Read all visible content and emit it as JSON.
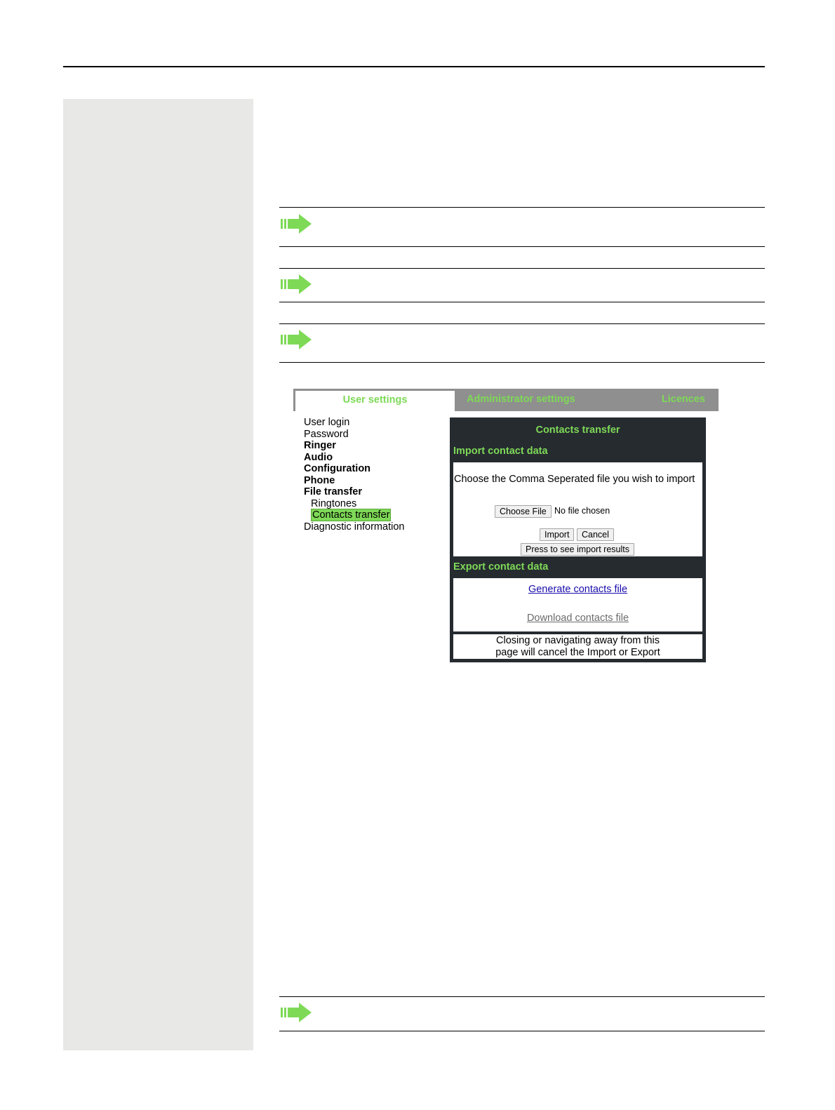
{
  "document": {
    "note_icon": "green-arrow-icon",
    "accent_color": "#7ed957",
    "sidebar_color": "#e8e8e7"
  },
  "screenshot": {
    "tabs": {
      "user": "User settings",
      "admin": "Administrator settings",
      "licences": "Licences"
    },
    "nav": {
      "user_login": "User login",
      "password": "Password",
      "ringer": "Ringer",
      "audio": "Audio",
      "configuration": "Configuration",
      "phone": "Phone",
      "file_transfer": "File transfer",
      "ringtones": "Ringtones",
      "contacts_transfer": "Contacts transfer",
      "diagnostic": "Diagnostic information"
    },
    "panel": {
      "title": "Contacts transfer",
      "import_heading": "Import contact data",
      "instruction": "Choose the Comma Seperated file you wish to import",
      "choose_file": "Choose File",
      "no_file": "No file chosen",
      "import": "Import",
      "cancel": "Cancel",
      "results": "Press to see import results",
      "export_heading": "Export contact data",
      "generate": "Generate contacts file",
      "download": "Download contacts file",
      "warning_line1": "Closing or navigating away from this",
      "warning_line2": "page will cancel the Import or Export"
    }
  }
}
